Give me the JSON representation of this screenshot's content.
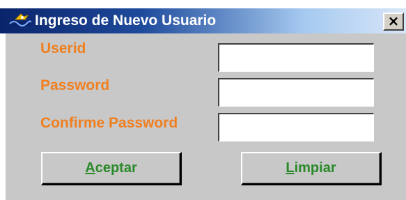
{
  "window": {
    "title": "Ingreso de Nuevo Usuario",
    "close_glyph": "×"
  },
  "form": {
    "userid_label": "Userid",
    "password_label": "Password",
    "confirm_label": "Confirme Password",
    "userid_value": "",
    "password_value": "",
    "confirm_value": ""
  },
  "buttons": {
    "accept": {
      "mnemonic": "A",
      "rest": "ceptar"
    },
    "clear": {
      "mnemonic": "L",
      "rest": "impiar"
    }
  },
  "icons": {
    "app": "app-icon",
    "close": "close-icon"
  },
  "colors": {
    "titlebar_start": "#0a246a",
    "titlebar_end": "#d8e6f8",
    "label_text": "#f07f20",
    "button_text": "#2a8a2a",
    "window_bg": "#c8c8c8"
  }
}
